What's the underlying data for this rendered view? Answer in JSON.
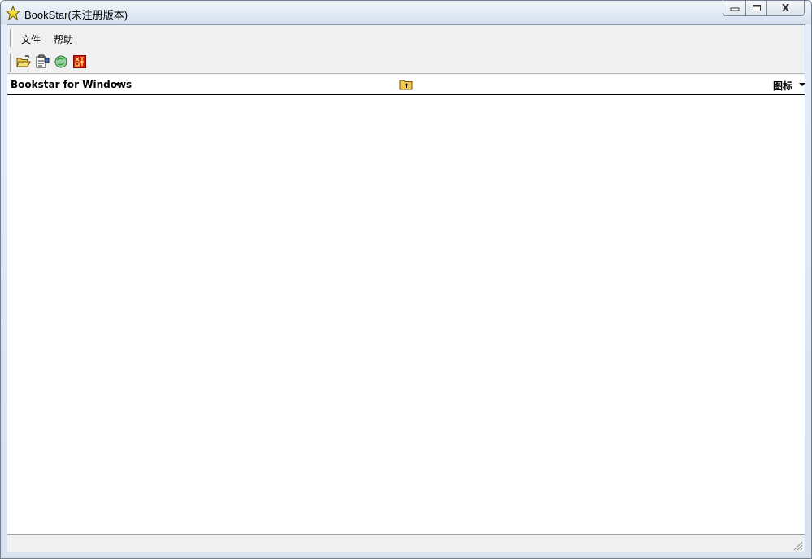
{
  "window": {
    "title": "BookStar(未注册版本)",
    "close_glyph": "X"
  },
  "menubar": {
    "items": [
      {
        "label": "文件"
      },
      {
        "label": "帮助"
      }
    ]
  },
  "toolbar": {
    "buttons": [
      {
        "icon": "open-folder-icon"
      },
      {
        "icon": "properties-icon"
      },
      {
        "icon": "refresh-globe-icon"
      },
      {
        "icon": "register-icon"
      }
    ]
  },
  "list_header": {
    "title": "Bookstar for Windows",
    "view_mode": "图标"
  },
  "colors": {
    "accent_red": "#d21c12",
    "folder_yellow": "#f2c94c",
    "globe_green": "#2e9b3a"
  }
}
